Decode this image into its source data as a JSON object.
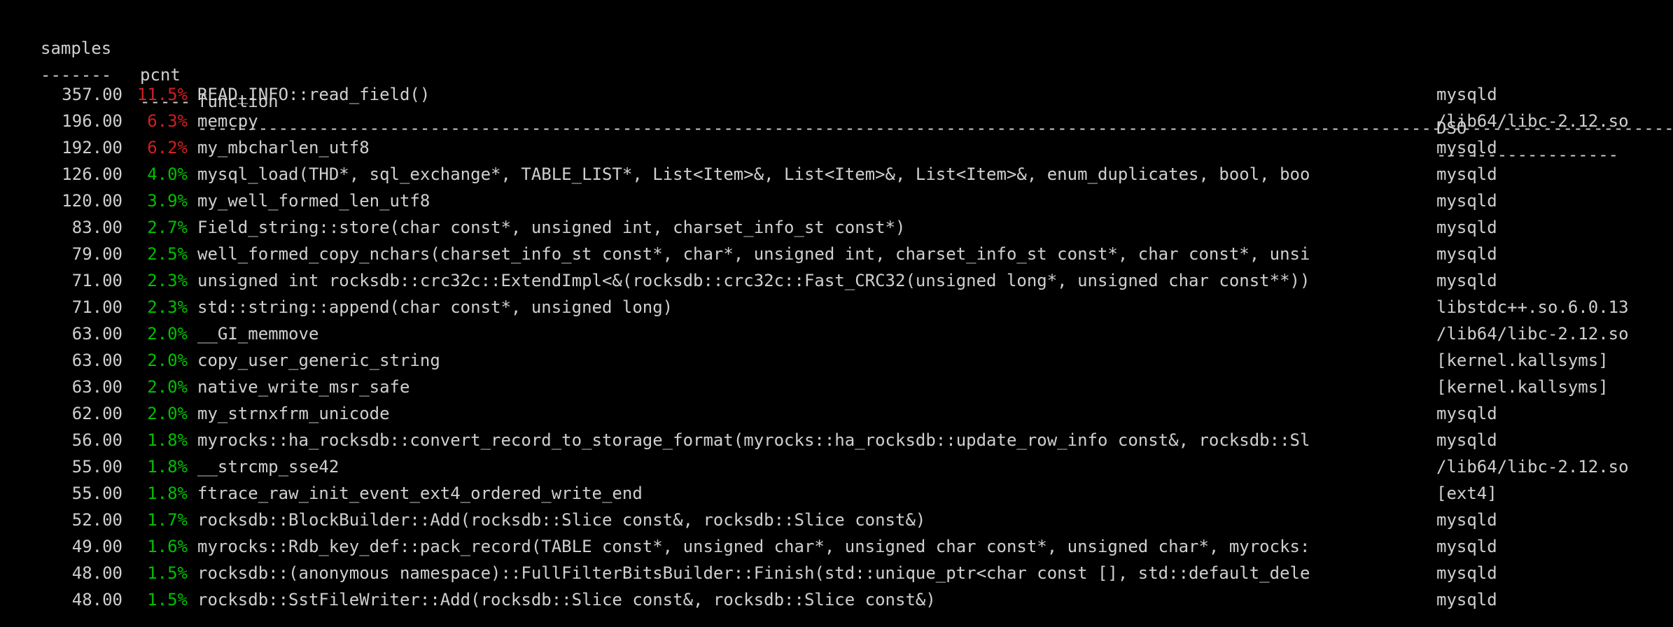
{
  "terminal": {
    "background_color": "#000000",
    "foreground_color": "#cfcfcf",
    "hot_color": "#d21f1f",
    "warm_color": "#00c000"
  },
  "header": {
    "samples": "samples",
    "pcnt": "pcnt",
    "function": "function",
    "dso": "DSO"
  },
  "rule": {
    "samples": "-------",
    "pcnt": "-----",
    "function": "---------------------------------------------------------------------------------------------------------------------------------------------------------------------------------------",
    "dso": "------------------"
  },
  "rows": [
    {
      "samples": "357.00",
      "pcnt": "11.5%",
      "pcnt_class": "pct-hot",
      "function": "READ_INFO::read_field()",
      "dso": "mysqld"
    },
    {
      "samples": "196.00",
      "pcnt": "6.3%",
      "pcnt_class": "pct-hot",
      "function": "memcpy",
      "dso": "/lib64/libc-2.12.so"
    },
    {
      "samples": "192.00",
      "pcnt": "6.2%",
      "pcnt_class": "pct-hot",
      "function": "my_mbcharlen_utf8",
      "dso": "mysqld"
    },
    {
      "samples": "126.00",
      "pcnt": "4.0%",
      "pcnt_class": "pct-warm",
      "function": "mysql_load(THD*, sql_exchange*, TABLE_LIST*, List<Item>&, List<Item>&, List<Item>&, enum_duplicates, bool, boo",
      "dso": "mysqld"
    },
    {
      "samples": "120.00",
      "pcnt": "3.9%",
      "pcnt_class": "pct-warm",
      "function": "my_well_formed_len_utf8",
      "dso": "mysqld"
    },
    {
      "samples": "83.00",
      "pcnt": "2.7%",
      "pcnt_class": "pct-warm",
      "function": "Field_string::store(char const*, unsigned int, charset_info_st const*)",
      "dso": "mysqld"
    },
    {
      "samples": "79.00",
      "pcnt": "2.5%",
      "pcnt_class": "pct-warm",
      "function": "well_formed_copy_nchars(charset_info_st const*, char*, unsigned int, charset_info_st const*, char const*, unsi",
      "dso": "mysqld"
    },
    {
      "samples": "71.00",
      "pcnt": "2.3%",
      "pcnt_class": "pct-warm",
      "function": "unsigned int rocksdb::crc32c::ExtendImpl<&(rocksdb::crc32c::Fast_CRC32(unsigned long*, unsigned char const**))",
      "dso": "mysqld"
    },
    {
      "samples": "71.00",
      "pcnt": "2.3%",
      "pcnt_class": "pct-warm",
      "function": "std::string::append(char const*, unsigned long)",
      "dso": "libstdc++.so.6.0.13"
    },
    {
      "samples": "63.00",
      "pcnt": "2.0%",
      "pcnt_class": "pct-warm",
      "function": "__GI_memmove",
      "dso": "/lib64/libc-2.12.so"
    },
    {
      "samples": "63.00",
      "pcnt": "2.0%",
      "pcnt_class": "pct-warm",
      "function": "copy_user_generic_string",
      "dso": "[kernel.kallsyms]"
    },
    {
      "samples": "63.00",
      "pcnt": "2.0%",
      "pcnt_class": "pct-warm",
      "function": "native_write_msr_safe",
      "dso": "[kernel.kallsyms]"
    },
    {
      "samples": "62.00",
      "pcnt": "2.0%",
      "pcnt_class": "pct-warm",
      "function": "my_strnxfrm_unicode",
      "dso": "mysqld"
    },
    {
      "samples": "56.00",
      "pcnt": "1.8%",
      "pcnt_class": "pct-warm",
      "function": "myrocks::ha_rocksdb::convert_record_to_storage_format(myrocks::ha_rocksdb::update_row_info const&, rocksdb::Sl",
      "dso": "mysqld"
    },
    {
      "samples": "55.00",
      "pcnt": "1.8%",
      "pcnt_class": "pct-warm",
      "function": "__strcmp_sse42",
      "dso": "/lib64/libc-2.12.so"
    },
    {
      "samples": "55.00",
      "pcnt": "1.8%",
      "pcnt_class": "pct-warm",
      "function": "ftrace_raw_init_event_ext4_ordered_write_end",
      "dso": "[ext4]"
    },
    {
      "samples": "52.00",
      "pcnt": "1.7%",
      "pcnt_class": "pct-warm",
      "function": "rocksdb::BlockBuilder::Add(rocksdb::Slice const&, rocksdb::Slice const&)",
      "dso": "mysqld"
    },
    {
      "samples": "49.00",
      "pcnt": "1.6%",
      "pcnt_class": "pct-warm",
      "function": "myrocks::Rdb_key_def::pack_record(TABLE const*, unsigned char*, unsigned char const*, unsigned char*, myrocks:",
      "dso": "mysqld"
    },
    {
      "samples": "48.00",
      "pcnt": "1.5%",
      "pcnt_class": "pct-warm",
      "function": "rocksdb::(anonymous namespace)::FullFilterBitsBuilder::Finish(std::unique_ptr<char const [], std::default_dele",
      "dso": "mysqld"
    },
    {
      "samples": "48.00",
      "pcnt": "1.5%",
      "pcnt_class": "pct-warm",
      "function": "rocksdb::SstFileWriter::Add(rocksdb::Slice const&, rocksdb::Slice const&)",
      "dso": "mysqld"
    }
  ]
}
